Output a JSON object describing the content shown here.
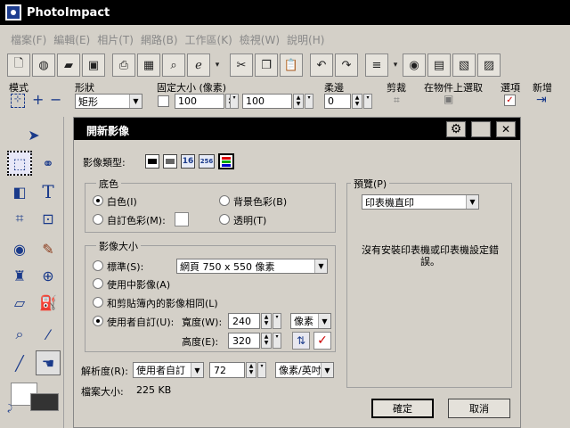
{
  "app": {
    "title": "PhotoImpact"
  },
  "menu": [
    "檔案(F)",
    "編輯(E)",
    "相片(T)",
    "網路(B)",
    "工作區(K)",
    "檢視(W)",
    "說明(H)"
  ],
  "props": {
    "mode_label": "模式",
    "shape_label": "形狀",
    "shape_value": "矩形",
    "fixed_size_label": "固定大小 (像素)",
    "width_value": "100",
    "height_value": "100",
    "soft_edge_label": "柔邊",
    "soft_edge_value": "0",
    "crop_label": "剪裁",
    "select_on_object_label": "在物件上選取",
    "options_label": "選項",
    "new_label": "新增"
  },
  "dialog": {
    "title": "開新影像",
    "image_type_label": "影像類型:",
    "image_type_buttons": [
      "16",
      "256"
    ],
    "bg_group": "底色",
    "bg_white": "白色(I)",
    "bg_background": "背景色彩(B)",
    "bg_custom": "自訂色彩(M):",
    "bg_transparent": "透明(T)",
    "size_group": "影像大小",
    "size_standard": "標準(S):",
    "size_standard_value": "網頁 750 x 550 像素",
    "size_medium": "使用中影像(A)",
    "size_clipboard": "和剪貼簿內的影像相同(L)",
    "size_custom": "使用者自訂(U):",
    "width_label": "寬度(W):",
    "width_value": "240",
    "height_label": "高度(E):",
    "height_value": "320",
    "unit_value": "像素",
    "resolution_label": "解析度(R):",
    "resolution_mode": "使用者自訂",
    "resolution_value": "72",
    "resolution_unit": "像素/英吋",
    "file_size_label": "檔案大小:",
    "file_size_value": "225 KB",
    "preview_group": "預覽(P)",
    "preview_value": "印表機直印",
    "preview_message": "沒有安裝印表機或印表機設定錯誤。",
    "ok_label": "確定",
    "cancel_label": "取消"
  },
  "colors": {
    "titlebar": "#000000",
    "accent": "#1a3a8a",
    "checkbox_mark": "#cc0000"
  }
}
